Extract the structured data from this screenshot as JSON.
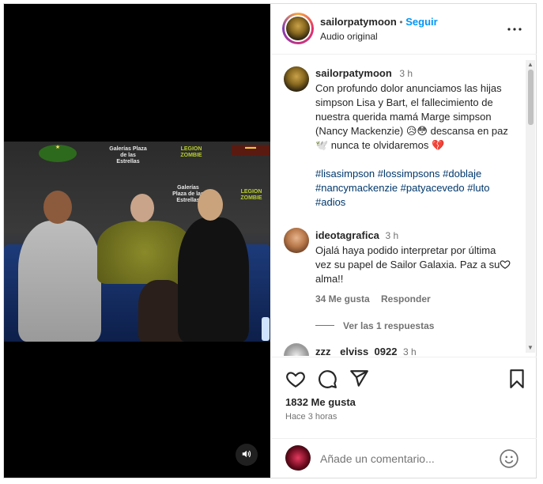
{
  "post": {
    "author": "sailorpatymoon",
    "audio": "Audio original",
    "follow_label": "Seguir",
    "dot": "•"
  },
  "caption": {
    "author": "sailorpatymoon",
    "time": "3 h",
    "text": "Con profundo dolor anunciamos las hijas simpson Lisa y Bart, el fallecimiento de nuestra querida mamá Marge simpson (Nancy Mackenzie) 😥😳 descansa en paz 🕊️ nunca te olvidaremos 💔",
    "hashtags": "#lisasimpson #lossimpsons #doblaje #nancymackenzie #patyacevedo #luto #adios"
  },
  "comments": [
    {
      "author": "ideotagrafica",
      "time": "3 h",
      "text": "Ojalá haya podido interpretar por última vez su papel de Sailor Galaxia. Paz a su alma!!",
      "likes": "34 Me gusta",
      "reply_label": "Responder",
      "view_replies": "Ver las 1 respuestas"
    },
    {
      "author": "elviss_0922",
      "author_prefix": "zzz",
      "time": "3 h"
    }
  ],
  "stats": {
    "likes": "1832 Me gusta",
    "posted": "Hace 3 horas"
  },
  "comment_input": {
    "placeholder": "Añade un comentario..."
  },
  "banners": [
    "Galerías Plaza de las Estrellas",
    "LEGION ZOMBIE",
    "Galerías Plaza de las Estrellas",
    "LEGION ZOMBIE"
  ],
  "icons": [
    "more-options-icon",
    "heart-icon",
    "comment-icon",
    "share-icon",
    "bookmark-icon",
    "emoji-icon",
    "volume-icon"
  ],
  "colors": {
    "accent": "#0095f6",
    "hashtag": "#00376b",
    "broken_heart": "#e0245e"
  }
}
